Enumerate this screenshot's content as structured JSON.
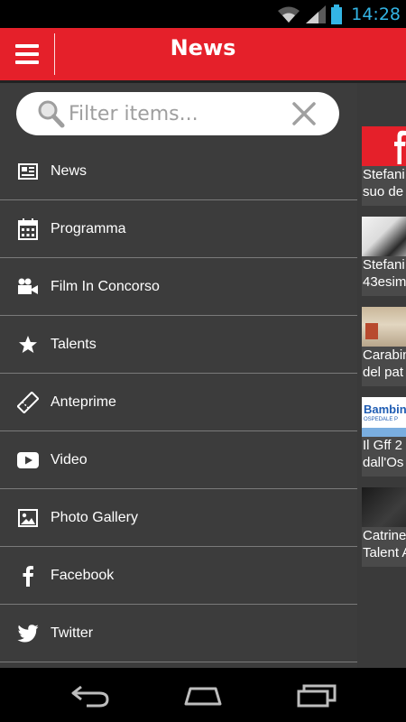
{
  "status": {
    "time": "14:28"
  },
  "header": {
    "title": "News",
    "menu_icon": "hamburger-icon"
  },
  "search": {
    "placeholder": "Filter items..."
  },
  "menu": [
    {
      "label": "News",
      "icon": "newspaper-icon"
    },
    {
      "label": "Programma",
      "icon": "calendar-icon"
    },
    {
      "label": "Film In Concorso",
      "icon": "video-camera-icon"
    },
    {
      "label": "Talents",
      "icon": "star-icon"
    },
    {
      "label": "Anteprime",
      "icon": "ticket-icon"
    },
    {
      "label": "Video",
      "icon": "play-icon"
    },
    {
      "label": "Photo Gallery",
      "icon": "image-icon"
    },
    {
      "label": "Facebook",
      "icon": "facebook-icon"
    },
    {
      "label": "Twitter",
      "icon": "twitter-icon"
    }
  ],
  "feed": [
    {
      "line1": "Stefani",
      "line2": "suo de"
    },
    {
      "line1": "Stefani",
      "line2": "43esim"
    },
    {
      "line1": "Carabin",
      "line2": "del pat"
    },
    {
      "line1": "Il Gff 2",
      "line2": "dall'Os",
      "thumb_text": "Bambin",
      "thumb_subtext": "OSPEDALE P"
    },
    {
      "line1": "Catrine",
      "line2": "Talent A"
    }
  ],
  "colors": {
    "brand_red": "#e5202a",
    "drawer_bg": "#3c3c3c",
    "clock_blue": "#33b5e5"
  }
}
